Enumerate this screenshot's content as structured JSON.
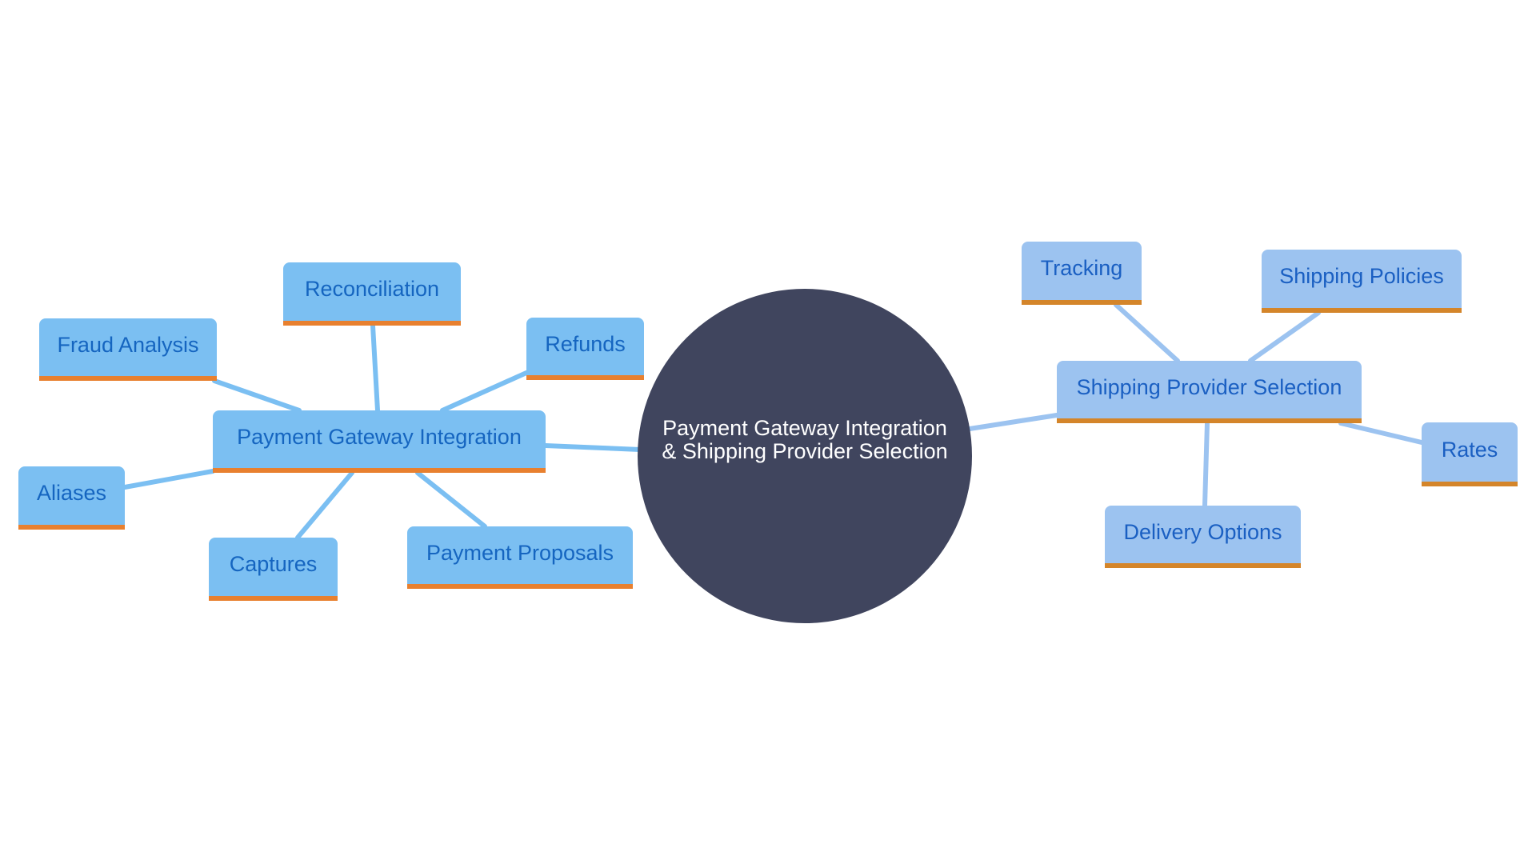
{
  "diagram": {
    "type": "mindmap",
    "root": {
      "line1": "Payment Gateway Integration",
      "line2": "& Shipping Provider Selection"
    },
    "branches": [
      {
        "label": "Payment Gateway Integration",
        "side": "left",
        "children": [
          "Reconciliation",
          "Fraud Analysis",
          "Refunds",
          "Aliases",
          "Captures",
          "Payment Proposals"
        ]
      },
      {
        "label": "Shipping Provider Selection",
        "side": "right",
        "children": [
          "Tracking",
          "Shipping Policies",
          "Rates",
          "Delivery Options"
        ]
      }
    ],
    "colors": {
      "root_fill": "#40455e",
      "root_text": "#ffffff",
      "left_node_fill": "#7bbff2",
      "left_node_accent": "#e8802f",
      "right_node_fill": "#9cc3f0",
      "right_node_accent": "#d4852a",
      "left_edge": "#7bbff2",
      "right_edge": "#9cc3f0",
      "node_text": "#1565c0"
    }
  }
}
